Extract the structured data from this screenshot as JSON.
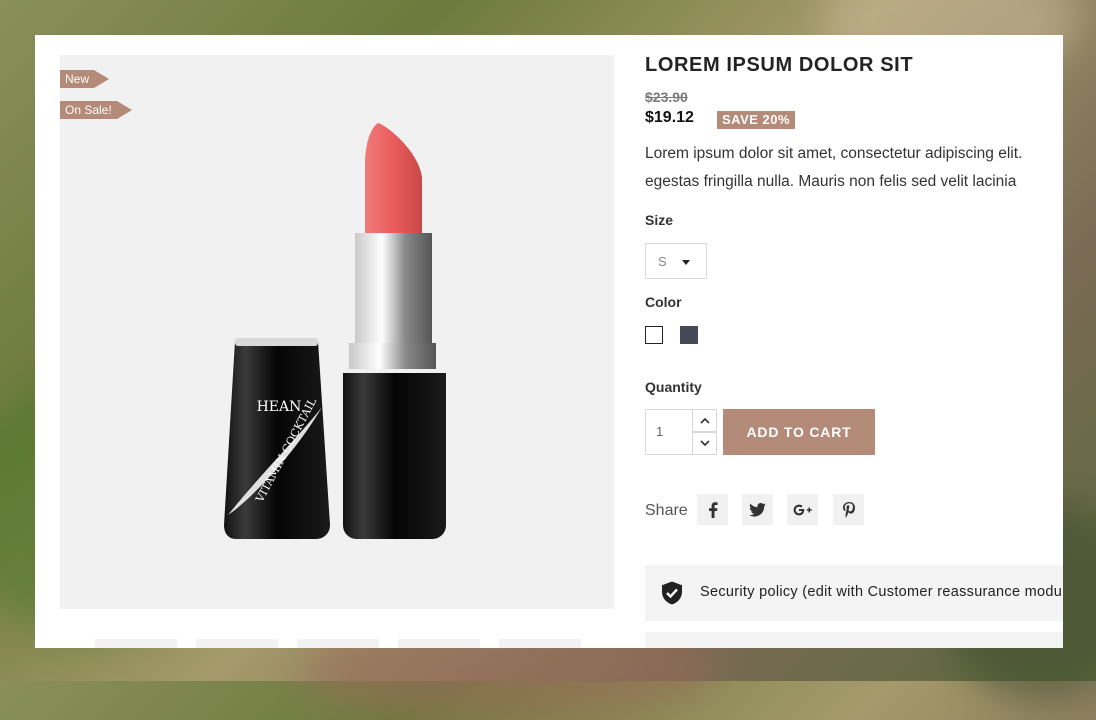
{
  "product": {
    "flags": [
      "New",
      "On Sale!"
    ],
    "title": "LOREM IPSUM DOLOR SIT",
    "old_price": "$23.90",
    "price": "$19.12",
    "discount": "SAVE 20%",
    "description": [
      "Lorem ipsum dolor sit amet, consectetur adipiscing elit.",
      "egestas fringilla nulla. Mauris non felis sed velit lacinia"
    ],
    "image": {
      "brand_text": "HEAN",
      "line_text": "VITAMIN COCKTAIL"
    }
  },
  "options": {
    "size_label": "Size",
    "size_value": "S",
    "color_label": "Color",
    "colors": [
      {
        "name": "white",
        "hex": "#ffffff"
      },
      {
        "name": "dark-gray",
        "hex": "#434a56"
      }
    ]
  },
  "cart": {
    "quantity_label": "Quantity",
    "quantity_value": "1",
    "add_to_cart": "ADD TO CART"
  },
  "share": {
    "label": "Share",
    "networks": [
      "facebook",
      "twitter",
      "google-plus",
      "pinterest"
    ]
  },
  "reassurance": {
    "text": "Security policy (edit with Customer reassurance module)",
    "icon": "shield-check-icon"
  },
  "colors": {
    "accent": "#b48a78",
    "panel_bg": "#f1f1f1"
  }
}
